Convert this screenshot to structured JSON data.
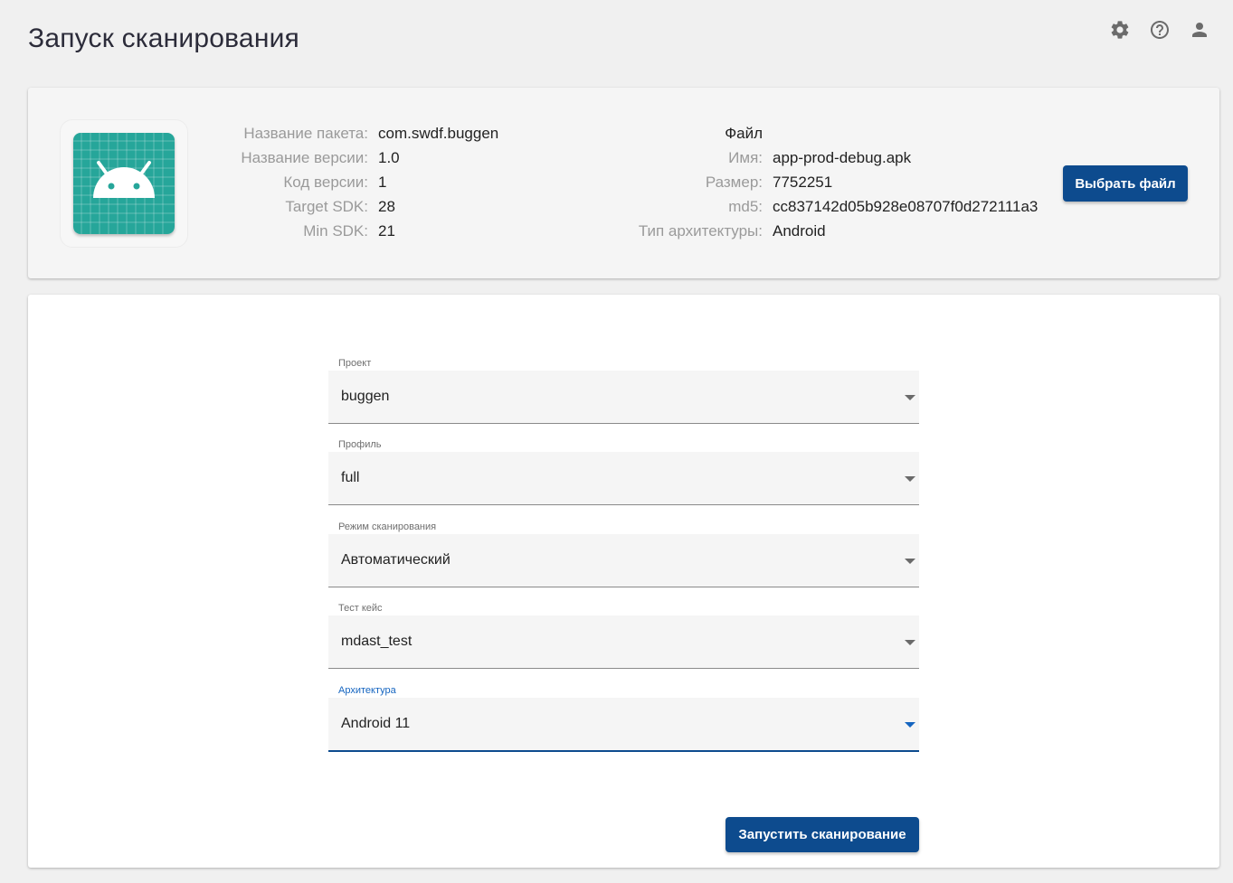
{
  "page": {
    "title": "Запуск сканирования"
  },
  "toolbar": {
    "icons": [
      "gear-icon",
      "help-icon",
      "account-icon"
    ]
  },
  "app_info": {
    "package_label": "Название пакета:",
    "package_value": "com.swdf.buggen",
    "version_name_label": "Название версии:",
    "version_name_value": "1.0",
    "version_code_label": "Код версии:",
    "version_code_value": "1",
    "target_sdk_label": "Target SDK:",
    "target_sdk_value": "28",
    "min_sdk_label": "Min SDK:",
    "min_sdk_value": "21"
  },
  "file_info": {
    "heading": "Файл",
    "name_label": "Имя:",
    "name_value": "app-prod-debug.apk",
    "size_label": "Размер:",
    "size_value": "7752251",
    "md5_label": "md5:",
    "md5_value": "cc837142d05b928e08707f0d272111a3",
    "arch_label": "Тип архитектуры:",
    "arch_value": "Android",
    "choose_button": "Выбрать файл"
  },
  "form": {
    "project": {
      "label": "Проект",
      "value": "buggen"
    },
    "profile": {
      "label": "Профиль",
      "value": "full"
    },
    "scan_mode": {
      "label": "Режим сканирования",
      "value": "Автоматический"
    },
    "test_case": {
      "label": "Тест кейс",
      "value": "mdast_test"
    },
    "architecture": {
      "label": "Архитектура",
      "value": "Android 11"
    },
    "submit_button": "Запустить сканирование"
  },
  "colors": {
    "primary": "#0d4b8e",
    "app_icon_bg": "#26a69a",
    "active_label": "#1565c0"
  }
}
